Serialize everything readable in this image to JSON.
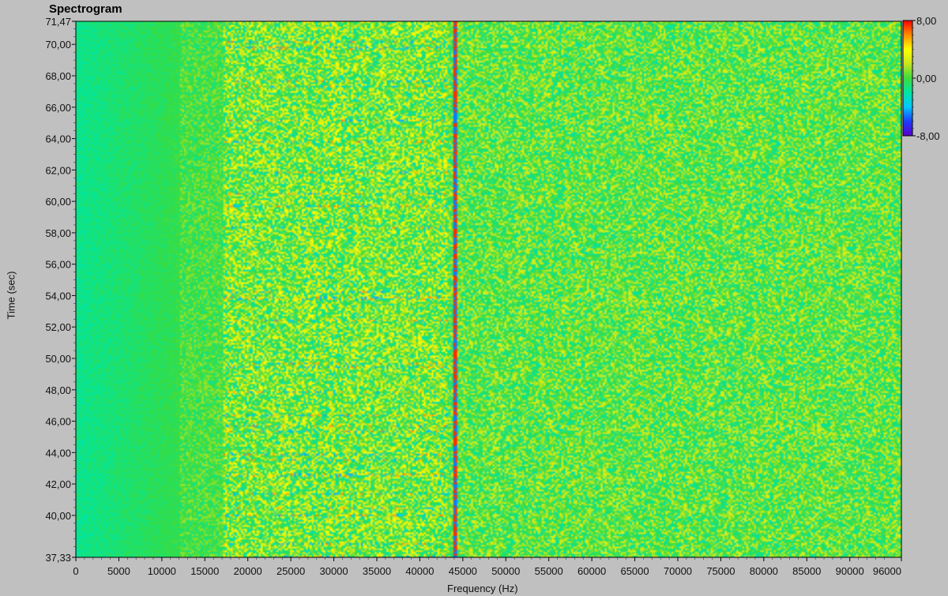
{
  "chart_data": {
    "type": "heatmap",
    "title": "Spectrogram",
    "xlabel": "Frequency (Hz)",
    "ylabel": "Time (sec)",
    "xlim": [
      0,
      96000
    ],
    "ylim": [
      37.33,
      71.47
    ],
    "x_ticks": [
      "0",
      "5000",
      "10000",
      "15000",
      "20000",
      "25000",
      "30000",
      "35000",
      "40000",
      "45000",
      "50000",
      "55000",
      "60000",
      "65000",
      "70000",
      "75000",
      "80000",
      "85000",
      "90000",
      "96000"
    ],
    "y_ticks": [
      "37,33",
      "40,00",
      "42,00",
      "44,00",
      "46,00",
      "48,00",
      "50,00",
      "52,00",
      "54,00",
      "56,00",
      "58,00",
      "60,00",
      "62,00",
      "64,00",
      "66,00",
      "68,00",
      "70,00",
      "71,47"
    ],
    "y_tick_values": [
      37.33,
      40,
      42,
      44,
      46,
      48,
      50,
      52,
      54,
      56,
      58,
      60,
      62,
      64,
      66,
      68,
      70,
      71.47
    ],
    "colorbar": {
      "range": [
        -8,
        8
      ],
      "labels": [
        "8,00",
        "0,00",
        "-8,00"
      ],
      "label_values": [
        8,
        0,
        -8
      ],
      "colors": [
        "#5a00c8",
        "#1e3cff",
        "#00c8ff",
        "#00e6a0",
        "#3cdc3c",
        "#c8e61e",
        "#ffff00",
        "#ff8c00",
        "#ff0000"
      ]
    },
    "features": {
      "narrowband_line_hz": 44000,
      "low_freq_region_hz": [
        0,
        15000
      ],
      "active_band_hz": [
        18000,
        42000
      ]
    },
    "grid": false
  }
}
